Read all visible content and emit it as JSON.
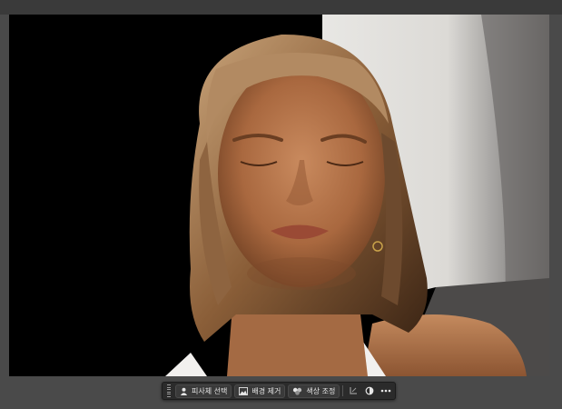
{
  "taskbar": {
    "select_subject_label": "피사체 선택",
    "remove_background_label": "배경 제거",
    "color_adjust_label": "색상 조정"
  },
  "icons": {
    "grip": "drag-handle-icon",
    "select_subject": "person-icon",
    "remove_background": "image-icon",
    "color_adjust": "color-circles-icon",
    "transform": "transform-icon",
    "adjustment": "half-circle-icon",
    "more": "more-dots-icon"
  },
  "colors": {
    "workspace": "#4a4a4a",
    "taskbar": "#2b2b2b",
    "canvas_background": "#000000"
  }
}
